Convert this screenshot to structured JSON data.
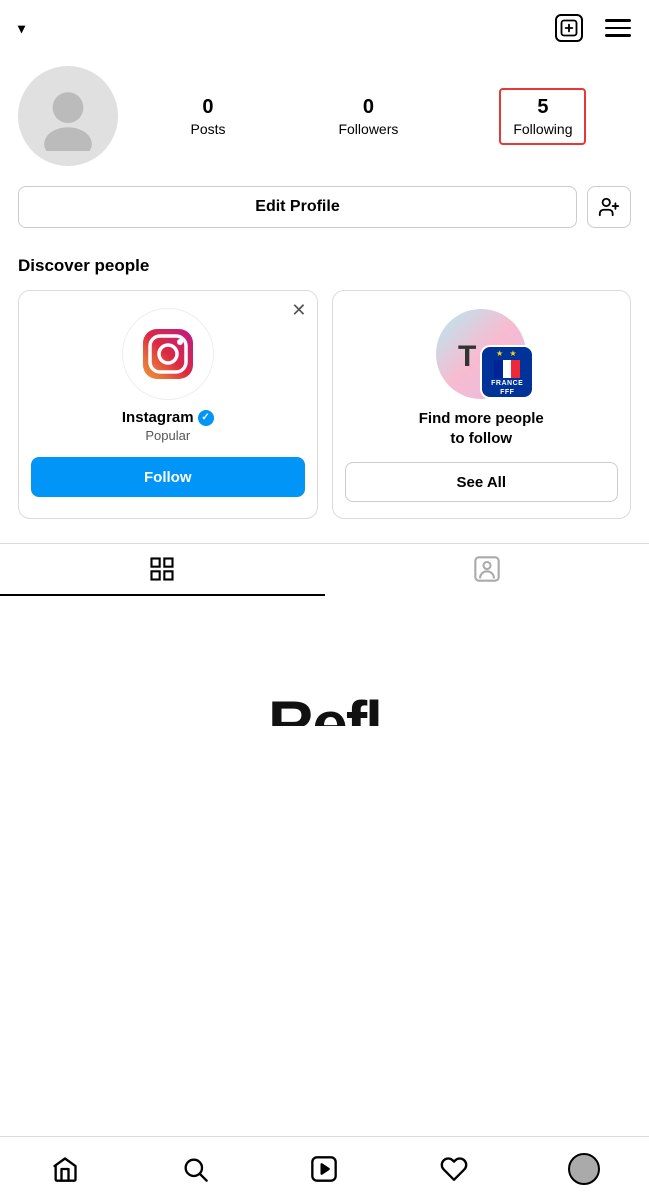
{
  "topbar": {
    "username": "",
    "chevron_label": "▾",
    "plus_icon": "+",
    "hamburger_label": "menu"
  },
  "profile": {
    "stats": [
      {
        "id": "posts",
        "number": "0",
        "label": "Posts"
      },
      {
        "id": "followers",
        "number": "0",
        "label": "Followers"
      },
      {
        "id": "following",
        "number": "5",
        "label": "Following"
      }
    ]
  },
  "edit_profile": {
    "label": "Edit Profile",
    "add_person_icon": "👤+"
  },
  "discover": {
    "section_title": "Discover people",
    "cards": [
      {
        "id": "instagram",
        "name": "Instagram",
        "subtitle": "Popular",
        "verified": true,
        "follow_label": "Follow"
      },
      {
        "id": "find-more",
        "title_line1": "Find more people",
        "title_line2": "to follow",
        "see_all_label": "See All"
      }
    ]
  },
  "tabs": [
    {
      "id": "grid",
      "icon": "grid",
      "active": true
    },
    {
      "id": "tagged",
      "icon": "person-tag",
      "active": false
    }
  ],
  "bottom_nav": {
    "items": [
      {
        "id": "home",
        "icon": "home"
      },
      {
        "id": "search",
        "icon": "search"
      },
      {
        "id": "reels",
        "icon": "play-square"
      },
      {
        "id": "heart",
        "icon": "heart"
      },
      {
        "id": "profile",
        "icon": "avatar"
      }
    ]
  },
  "content": {
    "partial_text": "Refl"
  }
}
